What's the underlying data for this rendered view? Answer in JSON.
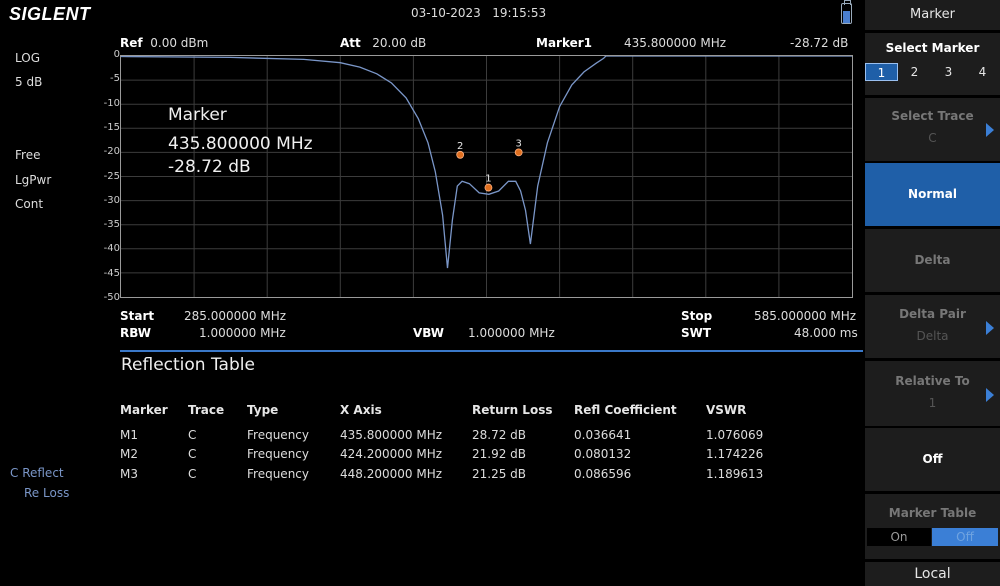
{
  "topbar": {
    "logo": "SIGLENT",
    "date": "03-10-2023",
    "time": "19:15:53"
  },
  "left_info": {
    "scale_type": "LOG",
    "scale_div": "5 dB",
    "mode1": "Free",
    "mode2": "LgPwr",
    "mode3": "Cont"
  },
  "header": {
    "ref_label": "Ref",
    "ref_value": "0.00 dBm",
    "att_label": "Att",
    "att_value": "20.00 dB",
    "marker_label": "Marker1",
    "marker_freq": "435.800000 MHz",
    "marker_value": "-28.72 dB"
  },
  "chart_data": {
    "type": "line",
    "xlabel": "",
    "ylabel": "",
    "x_unit": "MHz",
    "y_unit": "dB",
    "xlim": [
      285.0,
      585.0
    ],
    "ylim": [
      -50,
      0
    ],
    "y_ticks": [
      "0",
      "-5",
      "-10",
      "-15",
      "-20",
      "-25",
      "-30",
      "-35",
      "-40",
      "-45",
      "-50"
    ],
    "grid": true,
    "series": [
      {
        "color": "#7a96c8",
        "x": [
          285,
          330,
          360,
          375,
          383,
          390,
          396,
          402,
          407,
          411,
          414,
          417,
          419,
          421,
          423,
          425,
          428,
          432,
          436,
          440,
          444,
          447,
          449,
          451,
          453,
          456,
          460,
          465,
          470,
          475,
          480,
          483,
          484,
          585
        ],
        "y": [
          -0.1,
          -0.3,
          -0.7,
          -1.4,
          -2.3,
          -3.7,
          -5.6,
          -8.7,
          -13,
          -18,
          -24,
          -33,
          -44,
          -34,
          -27,
          -26,
          -26.5,
          -28.4,
          -28.7,
          -28,
          -26,
          -26,
          -28,
          -32,
          -39,
          -27,
          -18,
          -10.5,
          -6,
          -3.3,
          -1.5,
          -0.5,
          0,
          0
        ]
      }
    ],
    "markers": [
      {
        "label": "1",
        "x": 435.8,
        "y": -27.3
      },
      {
        "label": "2",
        "x": 424.2,
        "y": -20.5
      },
      {
        "label": "3",
        "x": 448.2,
        "y": -20.0
      }
    ]
  },
  "readout": {
    "title": "Marker",
    "freq": "435.800000 MHz",
    "value": "-28.72 dB"
  },
  "sweep": {
    "start_label": "Start",
    "start_value": "285.000000 MHz",
    "stop_label": "Stop",
    "stop_value": "585.000000 MHz",
    "rbw_label": "RBW",
    "rbw_value": "1.000000 MHz",
    "vbw_label": "VBW",
    "vbw_value": "1.000000 MHz",
    "swt_label": "SWT",
    "swt_value": "48.000 ms"
  },
  "table": {
    "title": "Reflection Table",
    "headers": [
      "Marker",
      "Trace",
      "Type",
      "X Axis",
      "Return Loss",
      "Refl Coefficient",
      "VSWR"
    ],
    "rows": [
      [
        "M1",
        "C",
        "Frequency",
        "435.800000 MHz",
        "28.72 dB",
        "0.036641",
        "1.076069"
      ],
      [
        "M2",
        "C",
        "Frequency",
        "424.200000 MHz",
        "21.92 dB",
        "0.080132",
        "1.174226"
      ],
      [
        "M3",
        "C",
        "Frequency",
        "448.200000 MHz",
        "21.25 dB",
        "0.086596",
        "1.189613"
      ]
    ]
  },
  "trace_legend": {
    "line1": "C Reflect",
    "line2": "Re Loss"
  },
  "panel": {
    "title": "Marker",
    "select_marker": "Select Marker",
    "marker_options": [
      "1",
      "2",
      "3",
      "4"
    ],
    "selected_marker": "1",
    "select_trace": "Select Trace",
    "select_trace_value": "C",
    "normal": "Normal",
    "delta": "Delta",
    "delta_pair": "Delta Pair",
    "delta_pair_value": "Delta",
    "relative_to": "Relative To",
    "relative_to_value": "1",
    "off": "Off",
    "marker_table": "Marker Table",
    "marker_table_on": "On",
    "marker_table_off": "Off",
    "local": "Local"
  }
}
